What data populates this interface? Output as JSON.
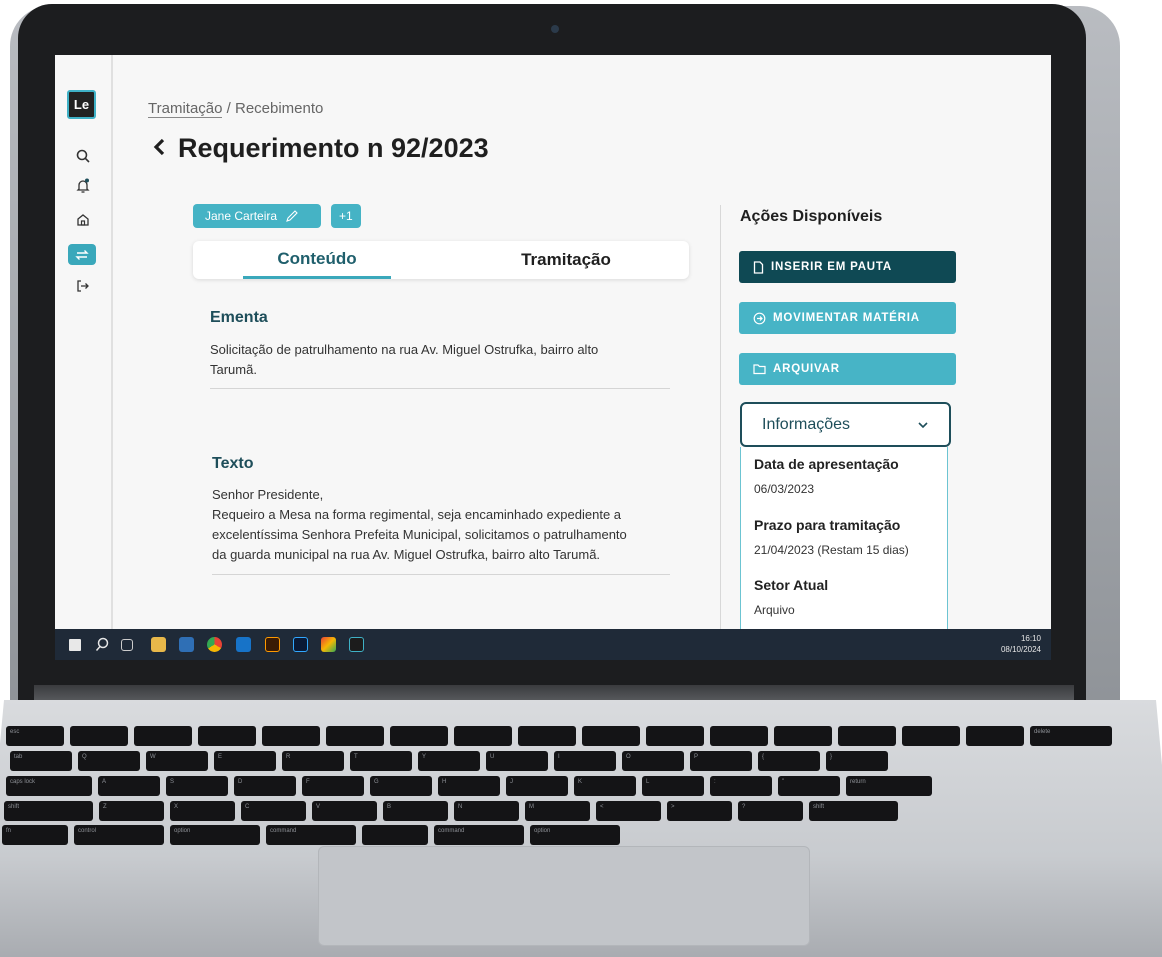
{
  "app": {
    "logo_text": "Le"
  },
  "breadcrumb": {
    "link": "Tramitação",
    "separator": " / ",
    "current": "Recebimento"
  },
  "header": {
    "title": "Requerimento n 92/2023"
  },
  "chips": {
    "author": "Jane Carteira",
    "more": "+1"
  },
  "tabs": [
    {
      "label": "Conteúdo",
      "active": true
    },
    {
      "label": "Tramitação",
      "active": false
    }
  ],
  "ementa": {
    "title": "Ementa",
    "line1": "Solicitação de patrulhamento na rua Av. Miguel Ostrufka, bairro alto",
    "line2": "Tarumã."
  },
  "texto": {
    "title": "Texto",
    "line1": "Senhor Presidente,",
    "line2": "Requeiro a Mesa na forma regimental, seja encaminhado expediente a",
    "line3": "excelentíssima Senhora Prefeita Municipal, solicitamos o patrulhamento",
    "line4": "da guarda municipal na rua Av. Miguel Ostrufka, bairro alto Tarumã."
  },
  "actions": {
    "title": "Ações Disponíveis",
    "insert": "INSERIR EM PAUTA",
    "move": "MOVIMENTAR MATÉRIA",
    "archive": "ARQUIVAR"
  },
  "info": {
    "header": "Informações",
    "items": [
      {
        "label": "Data de apresentação",
        "value": "06/03/2023"
      },
      {
        "label": "Prazo para tramitação",
        "value": "21/04/2023 (Restam 15 dias)"
      },
      {
        "label": "Setor Atual",
        "value": "Arquivo"
      }
    ]
  },
  "taskbar": {
    "time": "16:10",
    "date": "08/10/2024"
  },
  "keyboard": {
    "row1": [
      "esc",
      "",
      "",
      "",
      "",
      "",
      "",
      "",
      "",
      "",
      "",
      "",
      "",
      "",
      "",
      "",
      "delete"
    ],
    "row2": [
      "tab",
      "Q",
      "W",
      "E",
      "R",
      "T",
      "Y",
      "U",
      "I",
      "O",
      "P",
      "{",
      "}"
    ],
    "row3": [
      "caps lock",
      "A",
      "S",
      "D",
      "F",
      "G",
      "H",
      "J",
      "K",
      "L",
      ":",
      "\"",
      "return"
    ],
    "row4": [
      "shift",
      "Z",
      "X",
      "C",
      "V",
      "B",
      "N",
      "M",
      "<",
      ">",
      "?",
      "shift"
    ],
    "row5": [
      "fn",
      "control",
      "option",
      "command",
      "",
      "command",
      "option"
    ]
  },
  "colors": {
    "accent": "#3aa8bb",
    "dark": "#0f4954",
    "taskbar": "#1f2a38"
  }
}
